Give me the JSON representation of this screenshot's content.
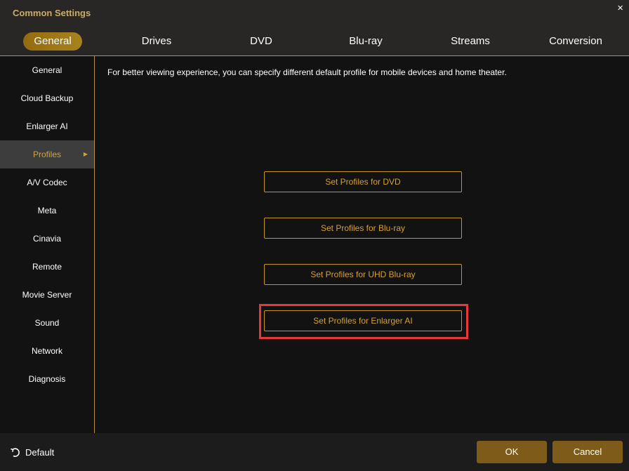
{
  "window": {
    "title": "Common Settings",
    "close_icon": "×"
  },
  "tabs": [
    {
      "label": "General"
    },
    {
      "label": "Drives"
    },
    {
      "label": "DVD"
    },
    {
      "label": "Blu-ray"
    },
    {
      "label": "Streams"
    },
    {
      "label": "Conversion"
    }
  ],
  "sidebar": {
    "items": [
      {
        "label": "General"
      },
      {
        "label": "Cloud Backup"
      },
      {
        "label": "Enlarger AI"
      },
      {
        "label": "Profiles"
      },
      {
        "label": "A/V Codec"
      },
      {
        "label": "Meta"
      },
      {
        "label": "Cinavia"
      },
      {
        "label": "Remote"
      },
      {
        "label": "Movie Server"
      },
      {
        "label": "Sound"
      },
      {
        "label": "Network"
      },
      {
        "label": "Diagnosis"
      }
    ],
    "active_arrow": "▶"
  },
  "main": {
    "description": "For better viewing experience, you can specify different default profile for mobile devices and home theater.",
    "buttons": [
      {
        "label": "Set Profiles for DVD"
      },
      {
        "label": "Set Profiles for Blu-ray"
      },
      {
        "label": "Set Profiles for UHD Blu-ray"
      },
      {
        "label": "Set Profiles for Enlarger AI"
      }
    ]
  },
  "footer": {
    "default_label": "Default",
    "ok_label": "OK",
    "cancel_label": "Cancel"
  }
}
